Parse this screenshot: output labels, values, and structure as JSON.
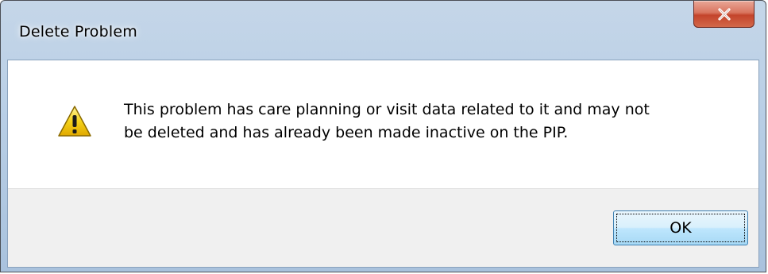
{
  "dialog": {
    "title": "Delete Problem",
    "message": "This problem has care planning or visit data related to it and may not\nbe deleted and has already been made inactive on the PIP.",
    "icon": "warning-icon",
    "ok_label": "OK",
    "close_icon": "close-icon"
  },
  "colors": {
    "close_button": "#c4442b",
    "warning_yellow": "#f5d31a",
    "footer_bg": "#f0f0f0",
    "button_border": "#3c7fb1"
  }
}
